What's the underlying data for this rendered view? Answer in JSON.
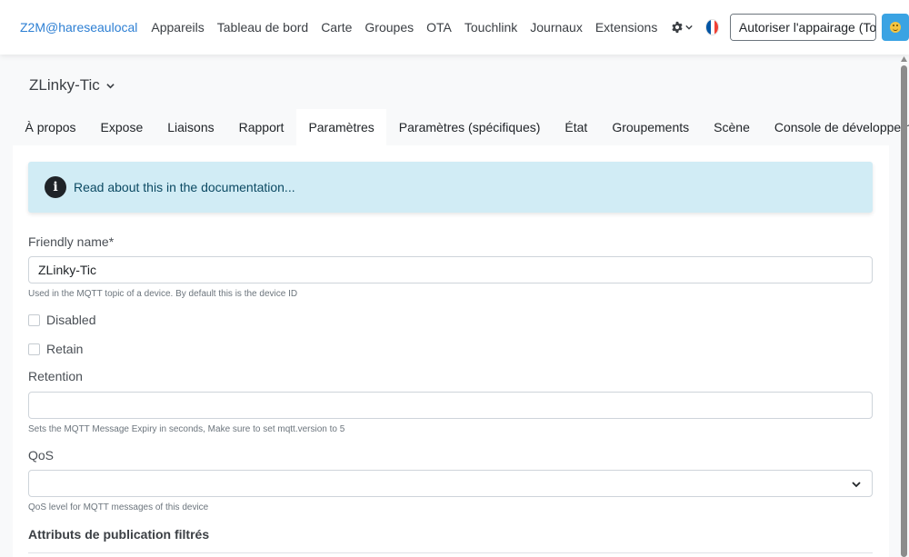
{
  "navbar": {
    "brand": "Z2M@hareseaulocal",
    "links": [
      "Appareils",
      "Tableau de bord",
      "Carte",
      "Groupes",
      "OTA",
      "Touchlink",
      "Journaux",
      "Extensions"
    ],
    "pair_button": "Autoriser l'appairage (Tout)",
    "flag_colors": [
      "#0055a4",
      "#ffffff",
      "#ef4135"
    ],
    "icons": {
      "settings": "gear-icon",
      "permit_toggle": "chevron-down-icon",
      "theme": "smiley-face-icon"
    }
  },
  "device": {
    "title": "ZLinky-Tic"
  },
  "tabs": [
    {
      "label": "À propos",
      "active": false
    },
    {
      "label": "Expose",
      "active": false
    },
    {
      "label": "Liaisons",
      "active": false
    },
    {
      "label": "Rapport",
      "active": false
    },
    {
      "label": "Paramètres",
      "active": true
    },
    {
      "label": "Paramètres (spécifiques)",
      "active": false
    },
    {
      "label": "État",
      "active": false
    },
    {
      "label": "Groupements",
      "active": false
    },
    {
      "label": "Scène",
      "active": false
    },
    {
      "label": "Console de développement",
      "active": false
    }
  ],
  "alert": {
    "text": "Read about this in the documentation...",
    "icon": "info-icon"
  },
  "form": {
    "friendly_name": {
      "label": "Friendly name*",
      "value": "ZLinky-Tic",
      "help": "Used in the MQTT topic of a device. By default this is the device ID"
    },
    "disabled": {
      "label": "Disabled",
      "checked": false
    },
    "retain": {
      "label": "Retain",
      "checked": false
    },
    "retention": {
      "label": "Retention",
      "value": "",
      "help": "Sets the MQTT Message Expiry in seconds, Make sure to set mqtt.version to 5"
    },
    "qos": {
      "label": "QoS",
      "value": "",
      "help": "QoS level for MQTT messages of this device"
    },
    "filtered_attributes": {
      "title": "Attributs de publication filtrés"
    }
  },
  "colors": {
    "brand": "#2d7fd3",
    "alert_bg": "#d1ecf5",
    "theme_button": "#3aa3e3",
    "page_bg": "#f8f9fa"
  }
}
